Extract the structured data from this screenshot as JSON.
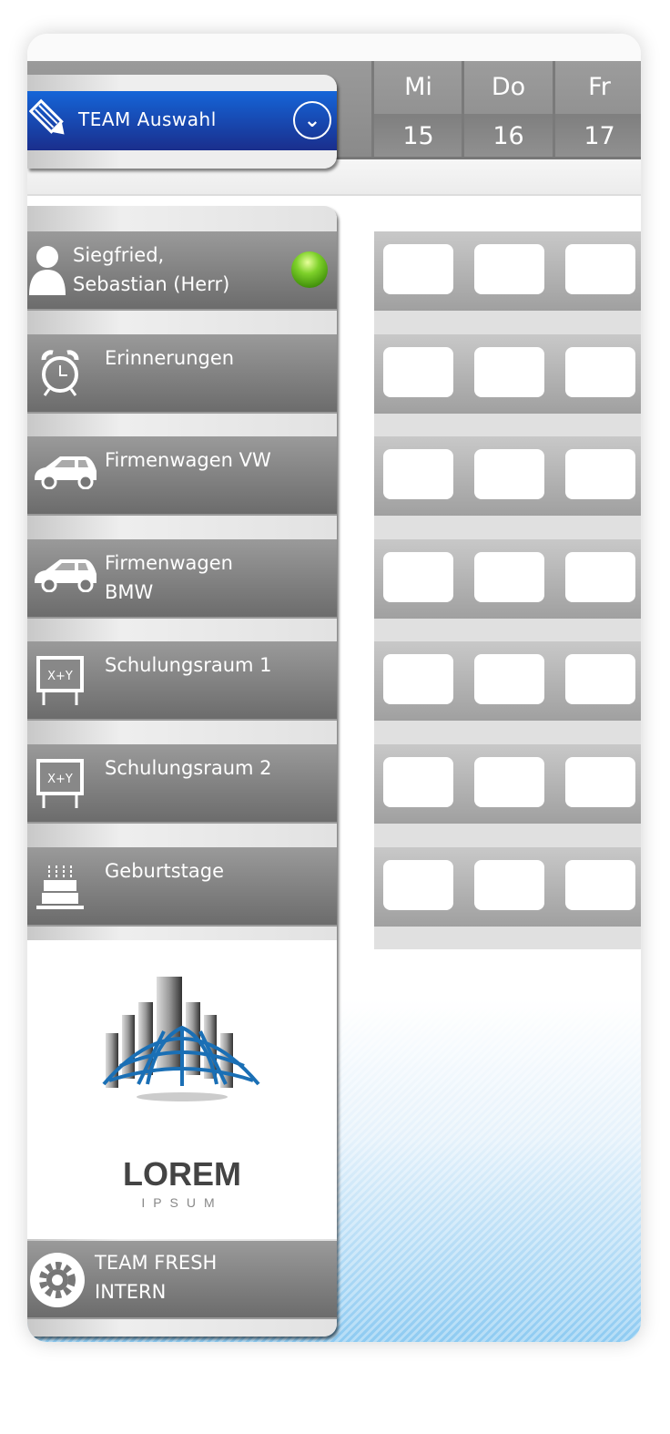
{
  "header": {
    "days": [
      {
        "name": "Mi",
        "date": "15"
      },
      {
        "name": "Do",
        "date": "16"
      },
      {
        "name": "Fr",
        "date": "17"
      }
    ]
  },
  "team_select": {
    "label": "TEAM Auswahl",
    "icon": "pencil-icon",
    "chevron": "chevron-down-circle-icon"
  },
  "resources": [
    {
      "label": "Siegfried, Sebastian (Herr)",
      "icon": "person-icon",
      "status": "online",
      "status_color": "#7ed12a"
    },
    {
      "label": "Erinnerungen",
      "icon": "alarm-clock-icon"
    },
    {
      "label": "Firmenwagen VW",
      "icon": "car-icon"
    },
    {
      "label": "Firmenwagen BMW",
      "icon": "car-icon"
    },
    {
      "label": "Schulungsraum 1",
      "icon": "whiteboard-icon",
      "icon_text": "X+Y"
    },
    {
      "label": "Schulungsraum 2",
      "icon": "whiteboard-icon",
      "icon_text": "X+Y"
    },
    {
      "label": "Geburtstage",
      "icon": "birthday-cake-icon"
    }
  ],
  "logo": {
    "title": "LOREM",
    "subtitle": "IPSUM"
  },
  "footer": {
    "label": "TEAM FRESH INTERN",
    "icon": "gear-icon"
  },
  "colors": {
    "accent": "#1565d8",
    "row": "#808080"
  }
}
